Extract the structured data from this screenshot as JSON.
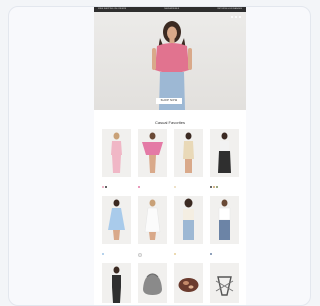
{
  "topbar": {
    "left": "FREE SHIPPING ON ORDERS",
    "center": "NEW ARRIVALS",
    "right": "RETURNS & EXCHANGES"
  },
  "hero": {
    "brand": "",
    "button_label": "SHOP NOW"
  },
  "section": {
    "title": "Casual Favorites"
  },
  "products": [
    {
      "name": "",
      "price": "",
      "swatches": [
        "#e8a0b8",
        "#333333"
      ]
    },
    {
      "name": "",
      "price": "",
      "swatches": [
        "#e47aa6"
      ]
    },
    {
      "name": "",
      "price": "",
      "swatches": [
        "#e9d9b8"
      ]
    },
    {
      "name": "",
      "price": "",
      "swatches": [
        "#3a3a3a",
        "#c8a068",
        "#7a8c5a"
      ]
    },
    {
      "name": "",
      "price": "",
      "swatches": [
        "#9fc3e6"
      ]
    },
    {
      "name": "",
      "price": "",
      "swatches": [
        "#f2f2f2"
      ]
    },
    {
      "name": "",
      "price": "",
      "swatches": [
        "#e6cf9a"
      ]
    },
    {
      "name": "",
      "price": "",
      "swatches": [
        "#6c84a6"
      ]
    },
    {
      "name": "",
      "price": "",
      "swatches": []
    },
    {
      "name": "",
      "price": "",
      "swatches": []
    },
    {
      "name": "",
      "price": "",
      "swatches": []
    },
    {
      "name": "",
      "price": "",
      "swatches": []
    }
  ],
  "colors": {
    "topbar": "#2e2e2e",
    "hero_bg": "#e8e6e3",
    "top_pink": "#e1738f"
  }
}
